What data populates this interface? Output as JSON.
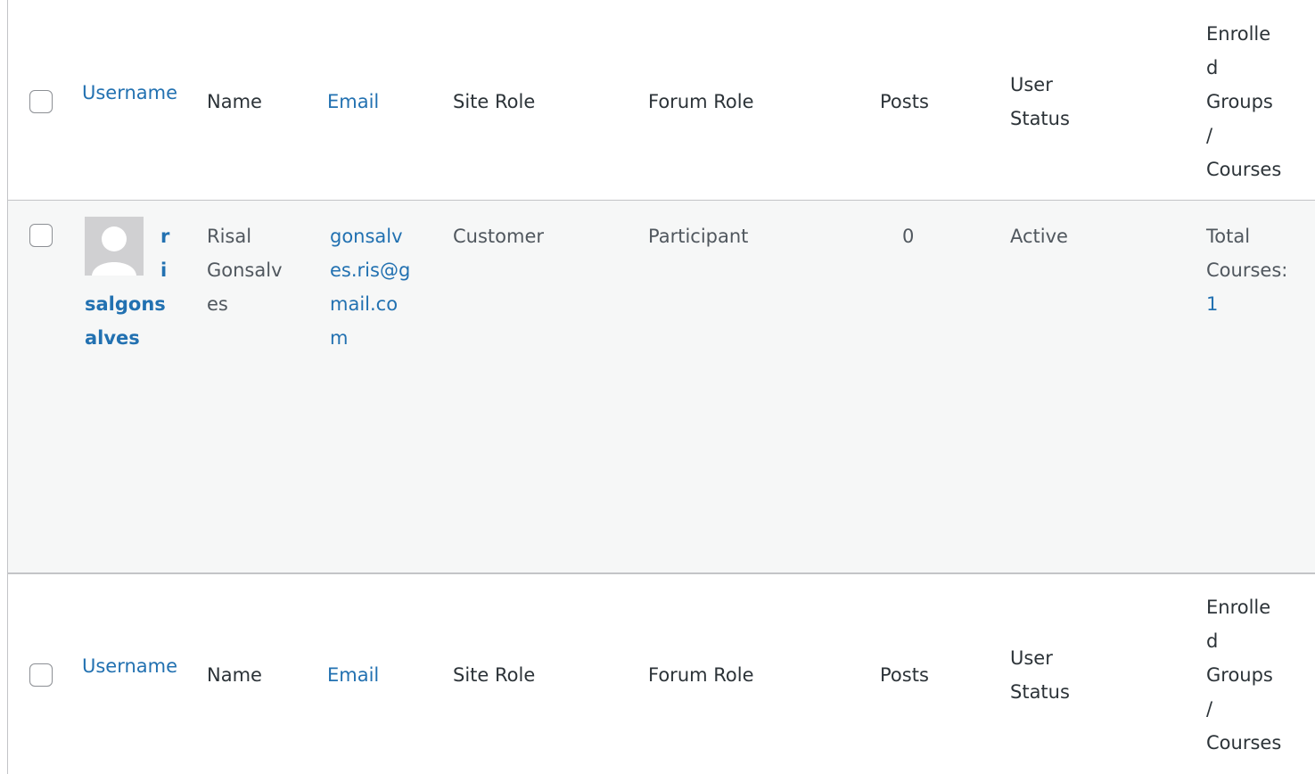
{
  "columns": {
    "username": "Username",
    "name": "Name",
    "email": "Email",
    "site_role": "Site Role",
    "forum_role": "Forum Role",
    "posts": "Posts",
    "user_status": [
      "User",
      "Status"
    ],
    "enrolled": [
      "Enrolle",
      "d",
      "Groups",
      "/",
      "Courses"
    ]
  },
  "row": {
    "username_lines": [
      "r",
      "i",
      "salgons",
      "alves"
    ],
    "name_lines": [
      "Risal",
      "Gonsalv",
      "es"
    ],
    "email_lines": [
      "gonsalv",
      "es.ris@g",
      "mail.co",
      "m"
    ],
    "site_role": "Customer",
    "forum_role": "Participant",
    "posts": "0",
    "status": "Active",
    "courses_label_lines": [
      "Total",
      "Courses:"
    ],
    "courses_count": "1"
  },
  "colors": {
    "link": "#2271b1",
    "text": "#2c3338",
    "row_bg": "#f6f7f7",
    "border": "#c3c4c7"
  }
}
